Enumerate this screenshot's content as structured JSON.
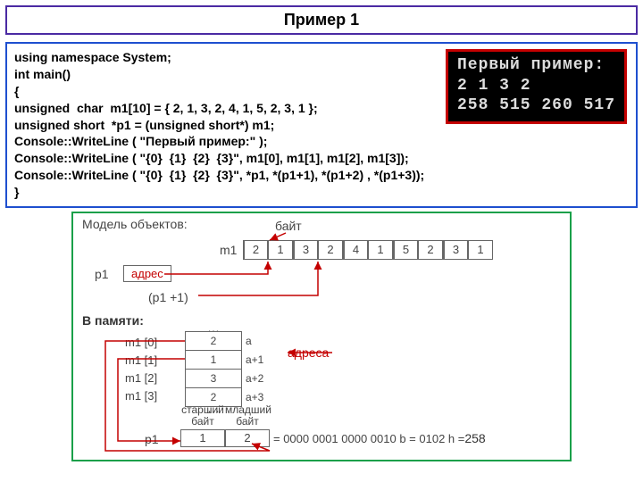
{
  "title": "Пример 1",
  "code": {
    "l1": "using namespace System;",
    "l2": "int main()",
    "l3": "{",
    "l4": "unsigned  char  m1[10] = { 2, 1, 3, 2, 4, 1, 5, 2, 3, 1 };",
    "l5": "unsigned short  *p1 = (unsigned short*) m1;",
    "l6": "Console::WriteLine ( \"Первый пример:\" );",
    "l7": "Console::WriteLine ( \"{0}  {1}  {2}  {3}\", m1[0], m1[1], m1[2], m1[3]);",
    "l8": "Console::WriteLine ( \"{0}  {1}  {2}  {3}\", *p1, *(p1+1), *(p1+2) , *(p1+3));",
    "l9": "}"
  },
  "output": {
    "line1": "Первый пример:",
    "line2": "2  1  3  2",
    "line3": "258  515  260  517"
  },
  "diagram": {
    "model_label": "Модель объектов:",
    "byte_top_label": "байт",
    "m1_label": "m1",
    "m1_cells": [
      "2",
      "1",
      "3",
      "2",
      "4",
      "1",
      "5",
      "2",
      "3",
      "1"
    ],
    "p1_label": "p1",
    "addr_text": "адрес",
    "p1_plus1": "(p1 +1)",
    "mem_label": "В памяти:",
    "mem_rows_labels": [
      "m1 [0]",
      "m1 [1]",
      "m1 [2]",
      "m1 [3]"
    ],
    "mem_dots_top": "…",
    "mem_values": [
      "2",
      "1",
      "3",
      "2"
    ],
    "mem_addrs": [
      "a",
      "a+1",
      "a+2",
      "a+3"
    ],
    "mem_dots_bot": "…",
    "addresses_label": "адреса",
    "hi_byte": "старший\nбайт",
    "lo_byte": "младший\nбайт",
    "p1_bottom_label": "p1",
    "p1_bytes": [
      "1",
      "2"
    ],
    "eq_text": " = 0000 0001 0000 0010 b = 0102 h = ",
    "eq_dec": "258"
  }
}
